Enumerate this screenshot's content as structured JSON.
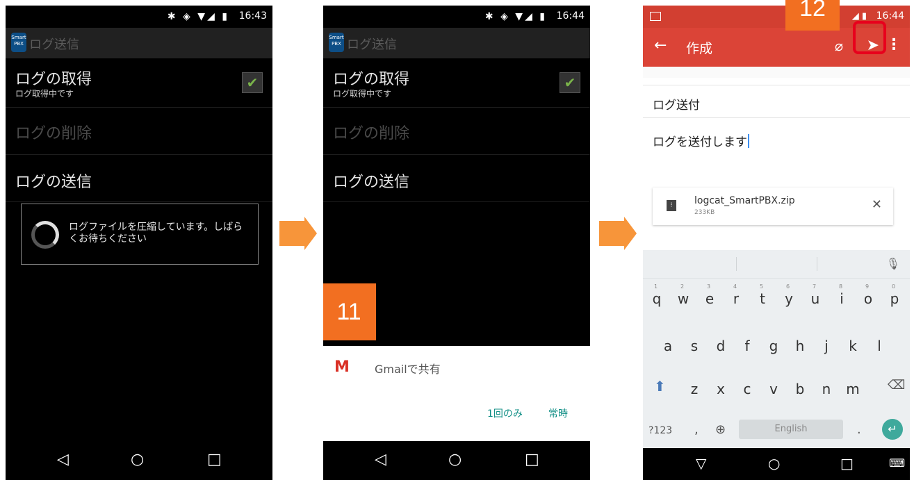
{
  "screen1": {
    "status": {
      "icons": "✱ ◈ ▼◢ ▮",
      "time": "16:43"
    },
    "app": {
      "logo": "Smart PBX",
      "title": "ログ送信"
    },
    "prefs": [
      {
        "title": "ログの取得",
        "subtitle": "ログ取得中です",
        "checked": true
      },
      {
        "title": "ログの削除",
        "disabled": true
      },
      {
        "title": "ログの送信"
      }
    ],
    "progress_message": "ログファイルを圧縮しています。しばらくお待ちください",
    "nav": {
      "back": "◁",
      "home": "○",
      "recents": "□"
    }
  },
  "screen2": {
    "status": {
      "icons": "✱ ◈ ▼◢ ▮",
      "time": "16:44"
    },
    "app": {
      "logo": "Smart PBX",
      "title": "ログ送信"
    },
    "prefs": [
      {
        "title": "ログの取得",
        "subtitle": "ログ取得中です",
        "checked": true
      },
      {
        "title": "ログの削除",
        "disabled": true
      },
      {
        "title": "ログの送信"
      }
    ],
    "step_badge": "11",
    "share_sheet": {
      "app_label": "Gmailで共有",
      "just_once": "1回のみ",
      "always": "常時"
    },
    "nav": {
      "back": "◁",
      "home": "○",
      "recents": "□"
    }
  },
  "screen3": {
    "status": {
      "icons": "◢ ▮",
      "time": "16:44"
    },
    "step_badge": "12",
    "toolbar": {
      "back": "←",
      "title": "作成",
      "attach": "⌀",
      "send": "➤",
      "more": "⋮"
    },
    "subject": "ログ送付",
    "body": "ログを送付します",
    "attachment": {
      "name": "logcat_SmartPBX.zip",
      "size": "233KB",
      "close": "✕"
    },
    "keyboard": {
      "row1": [
        "q",
        "w",
        "e",
        "r",
        "t",
        "y",
        "u",
        "i",
        "o",
        "p"
      ],
      "row1_nums": [
        "1",
        "2",
        "3",
        "4",
        "5",
        "6",
        "7",
        "8",
        "9",
        "0"
      ],
      "row2": [
        "a",
        "s",
        "d",
        "f",
        "g",
        "h",
        "j",
        "k",
        "l"
      ],
      "row3": [
        "z",
        "x",
        "c",
        "v",
        "b",
        "n",
        "m"
      ],
      "shift": "⬆",
      "backspace": "⌫",
      "symbols": "?123",
      "comma": ",",
      "globe": "⊕",
      "space": "English",
      "period": ".",
      "enter": "↵",
      "mic": "🎤"
    },
    "nav": {
      "back": "▽",
      "home": "○",
      "recents": "□",
      "keyboard": "⌨"
    }
  },
  "colors": {
    "accent_orange": "#f26f21",
    "arrow_orange": "#f7953a",
    "gmail_red": "#db4437",
    "highlight_red": "#e8001c",
    "teal": "#118f86"
  }
}
